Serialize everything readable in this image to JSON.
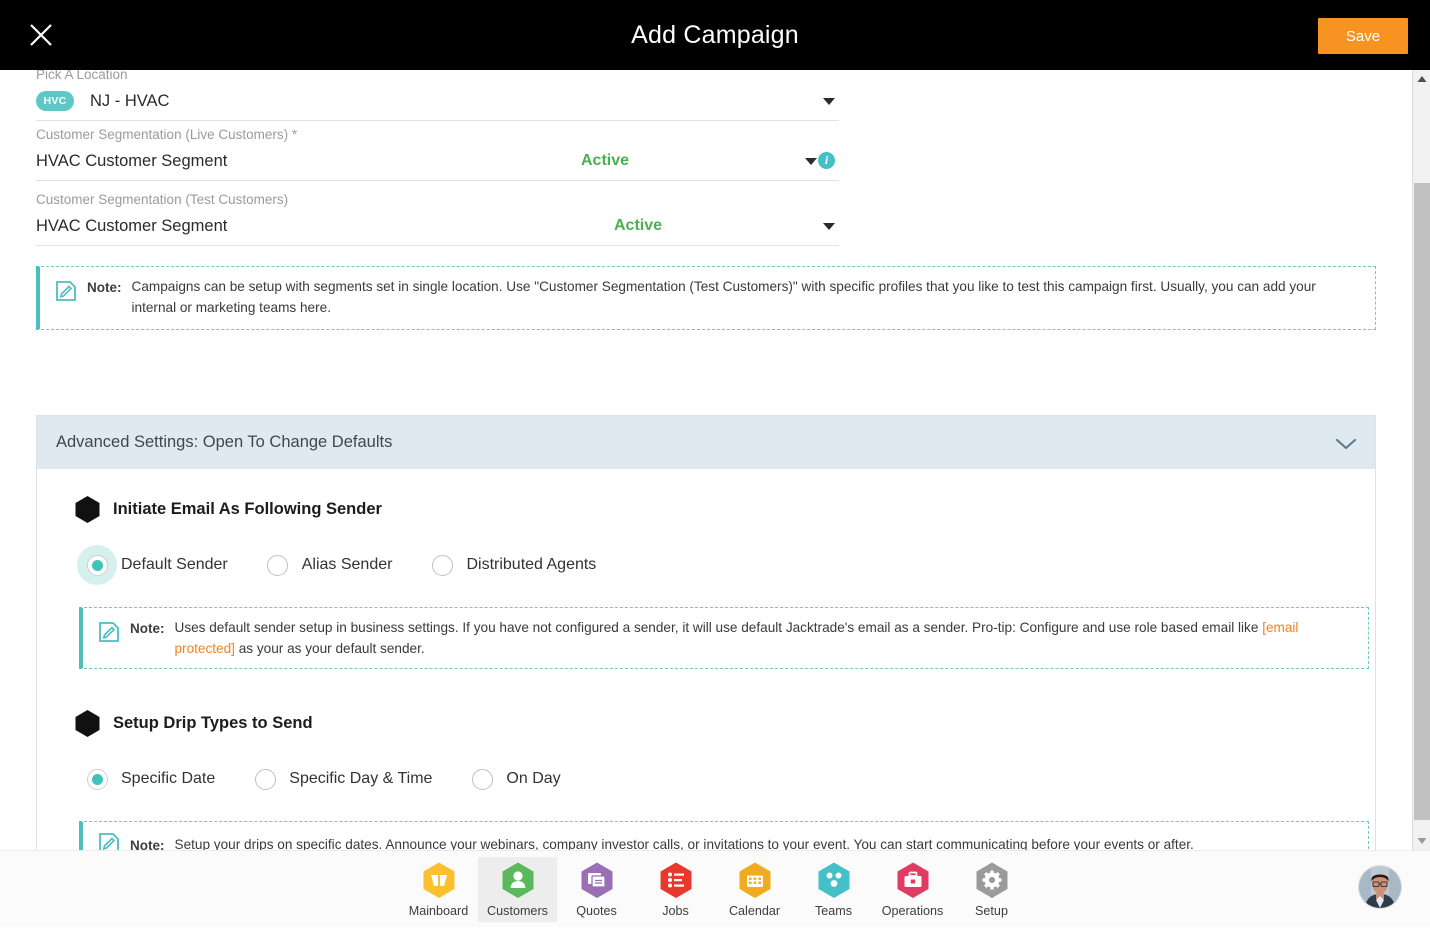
{
  "header": {
    "title": "Add Campaign",
    "close_icon": "close-icon",
    "save_label": "Save"
  },
  "form": {
    "location": {
      "label": "Pick A Location",
      "badge": "HVC",
      "value": "NJ - HVAC",
      "caret_icon": "chevron-down-icon"
    },
    "live_segmentation": {
      "label": "Customer Segmentation (Live Customers) *",
      "value": "HVAC Customer Segment",
      "status": "Active",
      "caret_icon": "chevron-down-icon",
      "info_icon": "info-icon",
      "info_glyph": "i"
    },
    "test_segmentation": {
      "label": "Customer Segmentation (Test Customers)",
      "value": "HVAC Customer Segment",
      "status": "Active",
      "caret_icon": "chevron-down-icon"
    }
  },
  "notes": {
    "segmentation": {
      "label": "Note:",
      "icon": "note-pencil-icon",
      "text": "Campaigns can be setup with segments set in single location. Use \"Customer Segmentation (Test Customers)\" with specific profiles that you like to test this campaign first. Usually, you can add your internal or marketing teams here."
    },
    "sender": {
      "label": "Note:",
      "icon": "note-pencil-icon",
      "text_before": "Uses default sender setup in business settings. If you have not configured a sender, it will use default Jacktrade's email as a sender. Pro-tip: Configure and use role based email like ",
      "email_link": "[email protected]",
      "text_after": " as your as your default sender."
    },
    "drip": {
      "label": "Note:",
      "icon": "note-pencil-icon",
      "text": "Setup your drips on specific dates. Announce your webinars, company investor calls, or invitations to your event. You can start communicating before your events or after."
    }
  },
  "advanced": {
    "header_title": "Advanced Settings: Open To Change Defaults",
    "chevron_icon": "chevron-down-icon",
    "sender_section": {
      "bullet_icon": "hexagon-bullet-icon",
      "title": "Initiate Email As Following Sender",
      "options": [
        {
          "label": "Default Sender",
          "checked": true
        },
        {
          "label": "Alias Sender",
          "checked": false
        },
        {
          "label": "Distributed Agents",
          "checked": false
        }
      ]
    },
    "drip_section": {
      "bullet_icon": "hexagon-bullet-icon",
      "title": "Setup Drip Types to Send",
      "options": [
        {
          "label": "Specific Date",
          "checked": true
        },
        {
          "label": "Specific Day & Time",
          "checked": false
        },
        {
          "label": "On Day",
          "checked": false
        }
      ]
    }
  },
  "scrollbar": {
    "up_icon": "triangle-up-icon",
    "down_icon": "triangle-down-icon"
  },
  "bottom_nav": {
    "items": [
      {
        "label": "Mainboard",
        "icon": "mainboard-icon",
        "color": "#fbc02d",
        "selected": false
      },
      {
        "label": "Customers",
        "icon": "customers-icon",
        "color": "#5cb85c",
        "selected": true
      },
      {
        "label": "Quotes",
        "icon": "quotes-icon",
        "color": "#9a6fb5",
        "selected": false
      },
      {
        "label": "Jobs",
        "icon": "jobs-icon",
        "color": "#e8382c",
        "selected": false
      },
      {
        "label": "Calendar",
        "icon": "calendar-icon",
        "color": "#f0ab1e",
        "selected": false
      },
      {
        "label": "Teams",
        "icon": "teams-icon",
        "color": "#45c0c8",
        "selected": false
      },
      {
        "label": "Operations",
        "icon": "operations-icon",
        "color": "#e23b63",
        "selected": false
      },
      {
        "label": "Setup",
        "icon": "setup-icon",
        "color": "#9b9b9b",
        "selected": false
      }
    ],
    "avatar_icon": "user-avatar"
  },
  "colors": {
    "accent_orange": "#f79421",
    "teal": "#45c0c8",
    "active_green": "#4caf50",
    "advanced_header_bg": "#dfe9f0"
  }
}
